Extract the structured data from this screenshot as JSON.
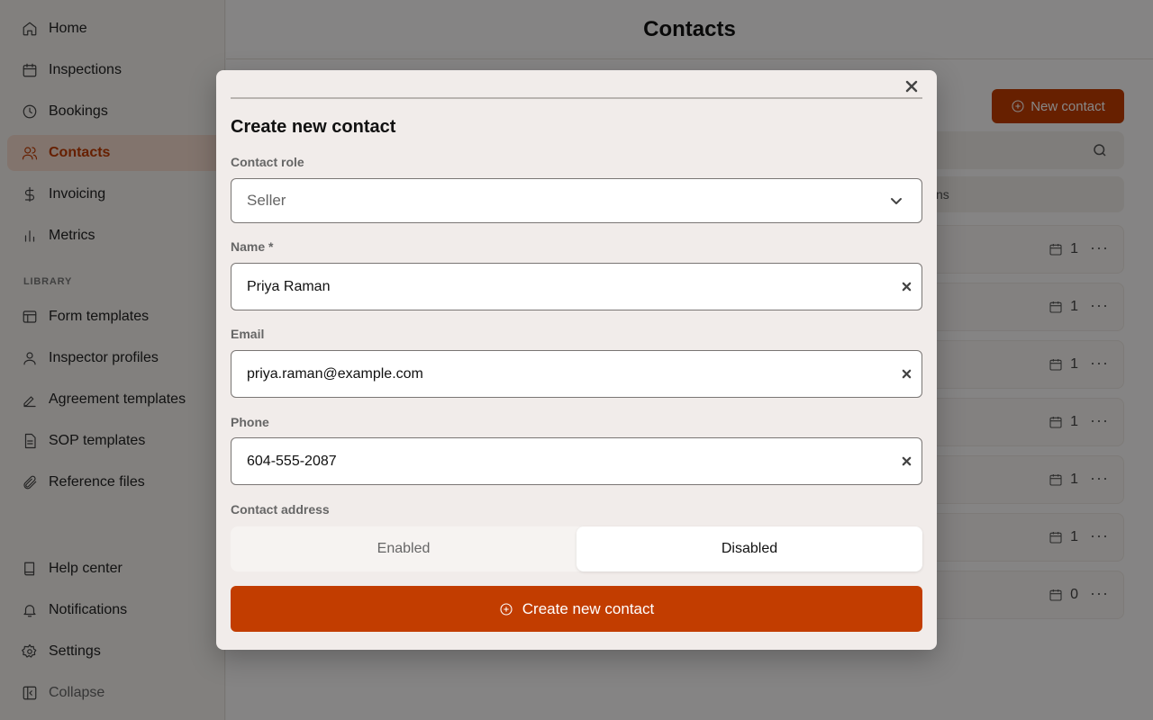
{
  "sidebar": {
    "items": [
      {
        "label": "Home",
        "icon": "home-icon"
      },
      {
        "label": "Inspections",
        "icon": "calendar-icon"
      },
      {
        "label": "Bookings",
        "icon": "clock-icon"
      },
      {
        "label": "Contacts",
        "icon": "users-icon",
        "active": true
      },
      {
        "label": "Invoicing",
        "icon": "dollar-icon"
      },
      {
        "label": "Metrics",
        "icon": "bar-chart-icon"
      }
    ],
    "section_label": "LIBRARY",
    "library_items": [
      {
        "label": "Form templates",
        "icon": "layout-icon"
      },
      {
        "label": "Inspector profiles",
        "icon": "user-icon"
      },
      {
        "label": "Agreement templates",
        "icon": "signature-icon"
      },
      {
        "label": "SOP templates",
        "icon": "file-text-icon"
      },
      {
        "label": "Reference files",
        "icon": "paperclip-icon"
      }
    ],
    "bottom_items": [
      {
        "label": "Help center",
        "icon": "book-icon"
      },
      {
        "label": "Notifications",
        "icon": "bell-icon"
      },
      {
        "label": "Settings",
        "icon": "gear-icon"
      },
      {
        "label": "Collapse",
        "icon": "sidebar-collapse-icon"
      }
    ]
  },
  "main": {
    "title": "Contacts",
    "new_contact_label": "New contact",
    "header_fragment": "ns",
    "rows": [
      {
        "count": "1"
      },
      {
        "count": "1"
      },
      {
        "count": "1"
      },
      {
        "count": "1"
      },
      {
        "count": "1"
      },
      {
        "count": "1"
      },
      {
        "count": "0"
      }
    ],
    "more_label": "···"
  },
  "modal": {
    "title": "Create new contact",
    "role_label": "Contact role",
    "role_value": "Seller",
    "name_label": "Name *",
    "name_value": "Priya Raman",
    "email_label": "Email",
    "email_value": "priya.raman@example.com",
    "phone_label": "Phone",
    "phone_value": "604-555-2087",
    "address_label": "Contact address",
    "address_options": {
      "enabled": "Enabled",
      "disabled": "Disabled"
    },
    "address_selected": "Disabled",
    "submit_label": "Create new contact"
  },
  "colors": {
    "accent": "#c23d00",
    "active_nav_bg": "#f6dccf",
    "overlay": "rgba(0,0,0,0.47)"
  }
}
